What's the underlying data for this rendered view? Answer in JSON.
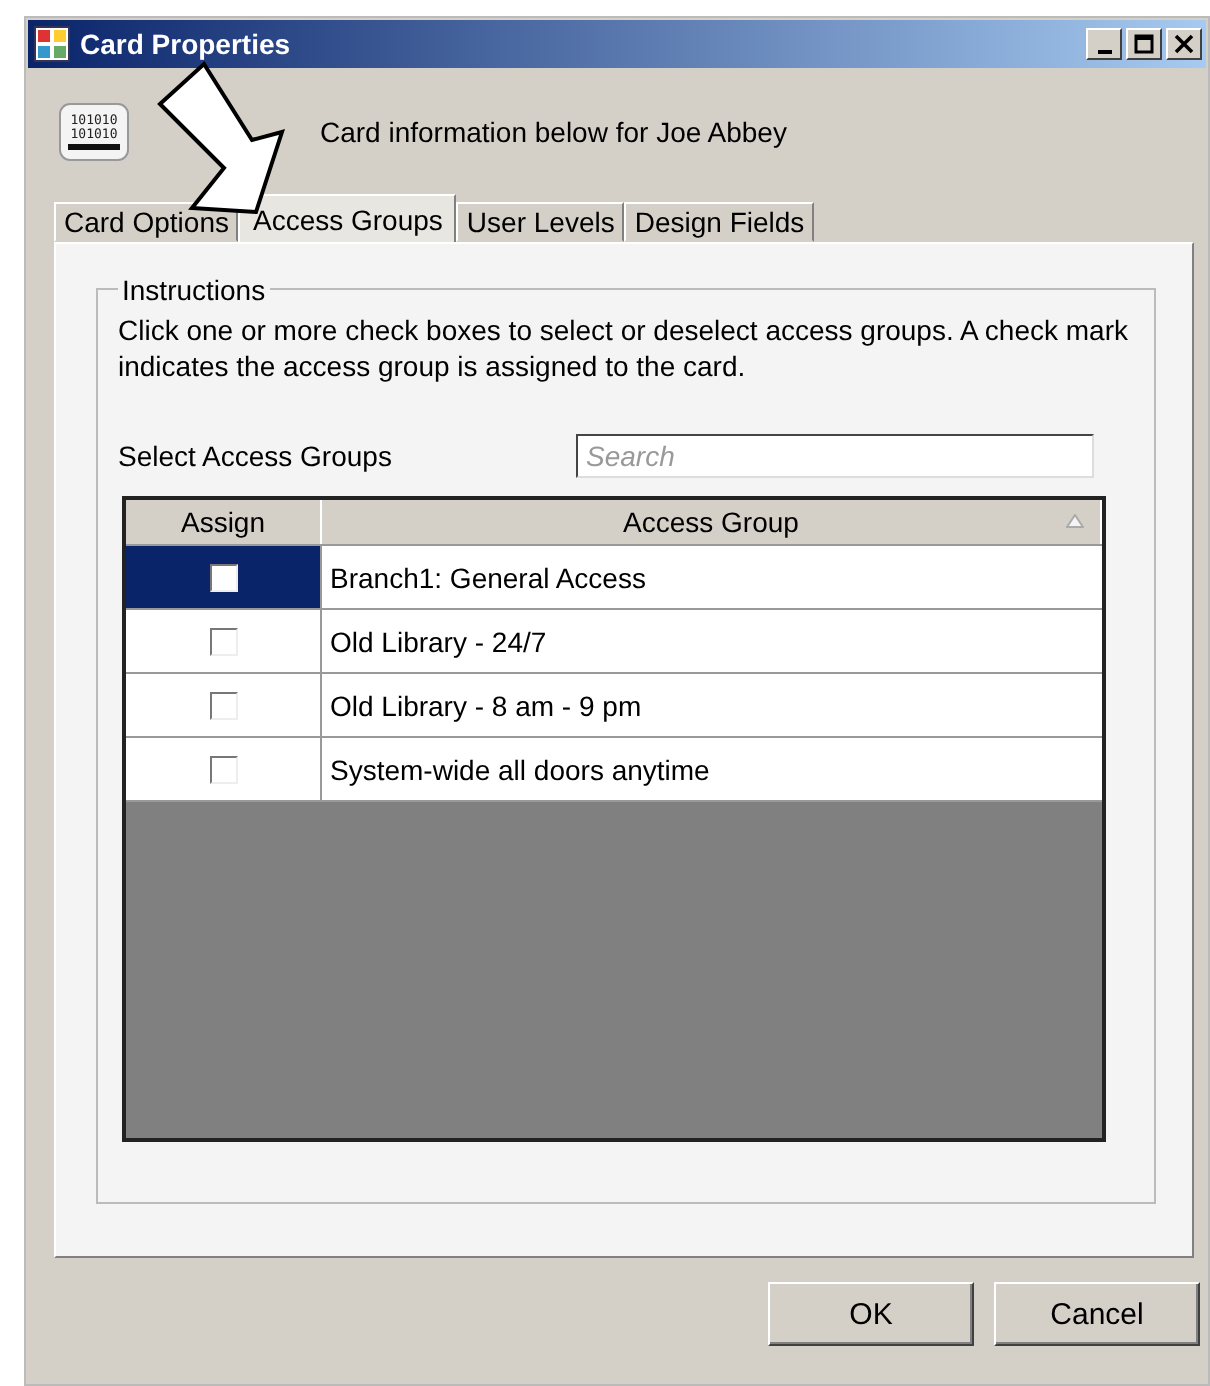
{
  "window": {
    "title": "Card Properties"
  },
  "header": {
    "icon_lines": [
      "101010",
      "101010"
    ],
    "text": "Card information below for Joe Abbey"
  },
  "tabs": [
    {
      "label": "Card Options",
      "selected": false
    },
    {
      "label": "Access Groups",
      "selected": true
    },
    {
      "label": "User Levels",
      "selected": false
    },
    {
      "label": "Design Fields",
      "selected": false
    }
  ],
  "instructions": {
    "title": "Instructions",
    "text": "Click one or more check boxes to select or deselect access groups.  A check mark indicates the access group is assigned to the card."
  },
  "select_label": "Select Access Groups",
  "search": {
    "placeholder": "Search"
  },
  "table": {
    "columns": [
      "Assign",
      "Access Group"
    ],
    "rows": [
      {
        "assigned": false,
        "selected": true,
        "group": "Branch1: General Access"
      },
      {
        "assigned": false,
        "selected": false,
        "group": "Old Library - 24/7"
      },
      {
        "assigned": false,
        "selected": false,
        "group": "Old Library - 8 am - 9 pm"
      },
      {
        "assigned": false,
        "selected": false,
        "group": "System-wide all doors anytime"
      }
    ]
  },
  "buttons": [
    "OK",
    "Cancel"
  ]
}
